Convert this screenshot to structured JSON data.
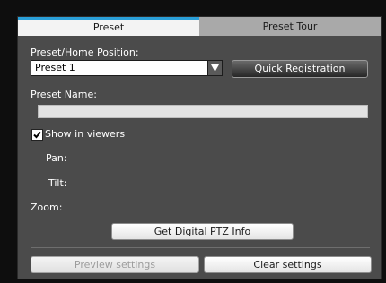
{
  "tabs": [
    {
      "label": "Preset",
      "active": true
    },
    {
      "label": "Preset Tour",
      "active": false
    }
  ],
  "preset_home": {
    "label": "Preset/Home Position:",
    "selected_value": "Preset 1"
  },
  "quick_registration": {
    "label": "Quick Registration"
  },
  "preset_name": {
    "label": "Preset Name:",
    "value": ""
  },
  "show_in_viewers": {
    "label": "Show in viewers",
    "checked": true
  },
  "position": {
    "pan_label": "Pan:",
    "tilt_label": "Tilt:",
    "zoom_label": "Zoom:"
  },
  "digital_ptz_button": {
    "label": "Get Digital PTZ Info"
  },
  "footer": {
    "preview_label": "Preview settings",
    "preview_enabled": false,
    "clear_label": "Clear settings"
  },
  "colors": {
    "panel_bg": "#4b4b4b",
    "active_tab_accent": "#2a9fd8",
    "inactive_tab_bg": "#a9a9a9"
  }
}
